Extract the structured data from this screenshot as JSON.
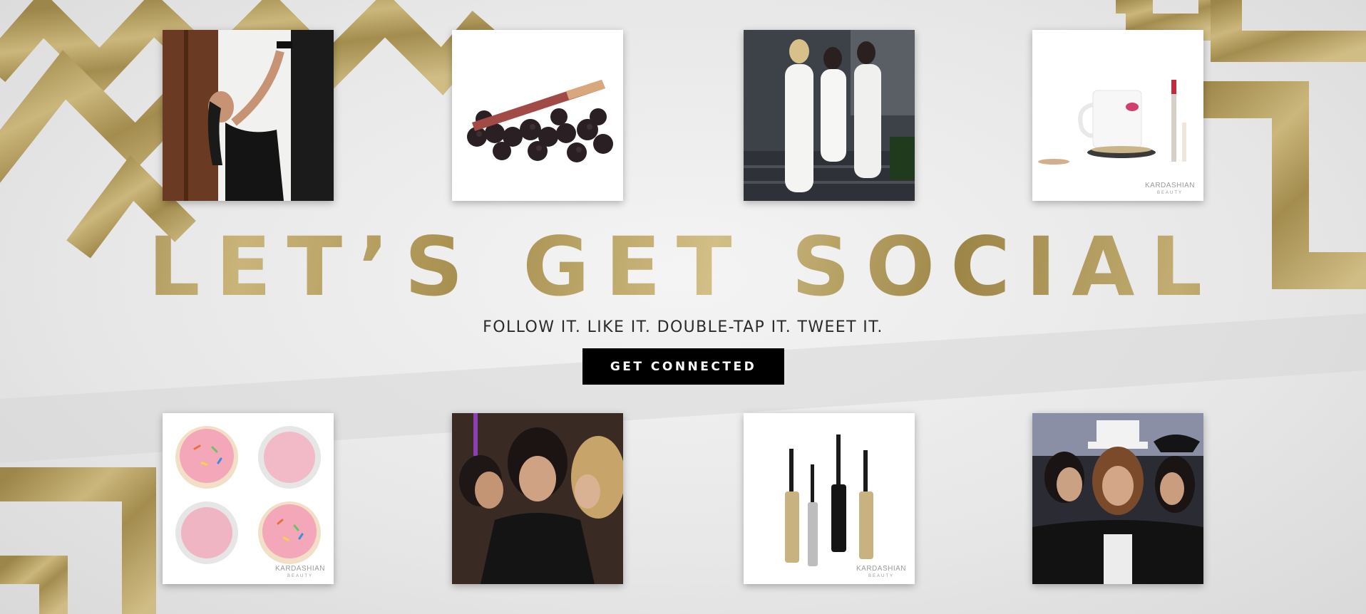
{
  "hero": {
    "headline": "LET’S GET SOCIAL",
    "tagline": "FOLLOW IT. LIKE IT. DOUBLE-TAP IT. TWEET IT.",
    "cta_label": "GET CONNECTED"
  },
  "tiles": {
    "top": [
      {
        "subject": "selfie-in-black-top"
      },
      {
        "subject": "lip-liner-with-blackberries"
      },
      {
        "subject": "three-women-in-white-on-steps"
      },
      {
        "subject": "mug-with-lipstick-print",
        "brand": "KARDASHIAN",
        "brand_sub": "BEAUTY"
      }
    ],
    "bottom": [
      {
        "subject": "cookies-and-blush-compacts",
        "brand": "KARDASHIAN",
        "brand_sub": "BEAUTY"
      },
      {
        "subject": "three-women-kissing-selfie"
      },
      {
        "subject": "four-mascara-wands",
        "brand": "KARDASHIAN",
        "brand_sub": "BEAUTY"
      },
      {
        "subject": "three-women-blowing-kisses"
      }
    ]
  },
  "colors": {
    "gold": "#b09a58",
    "cta_background": "#000000",
    "cta_text": "#ffffff",
    "tagline_text": "#2b2b2b"
  }
}
